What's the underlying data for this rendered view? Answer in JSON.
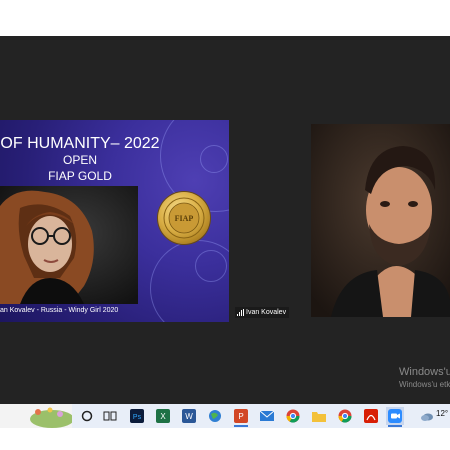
{
  "slide": {
    "title": "OF HUMANITY– 2022",
    "line2": "OPEN",
    "line3": "FIAP GOLD",
    "caption": "an Kovalev - Russia - Windy Girl 2020",
    "medal_text": "FIAP"
  },
  "participant": {
    "name": "Ivan Kovalev"
  },
  "watermark": {
    "line1": "Windows'u",
    "line2": "Windows'u etk"
  },
  "taskbar": {
    "apps": [
      "cortana-icon",
      "task-view-icon",
      "photoshop-icon",
      "excel-icon",
      "word-icon",
      "globe-icon",
      "powerpoint-icon",
      "mail-icon",
      "chrome-icon",
      "file-explorer-icon",
      "chrome-icon",
      "acrobat-icon",
      "zoom-icon"
    ],
    "weather_temp": "12°"
  },
  "colors": {
    "slide_bg": "#2e2488",
    "zoom_bg": "#232323",
    "taskbar_bg": "#e8eef8",
    "active_accent": "#3a78d6"
  }
}
